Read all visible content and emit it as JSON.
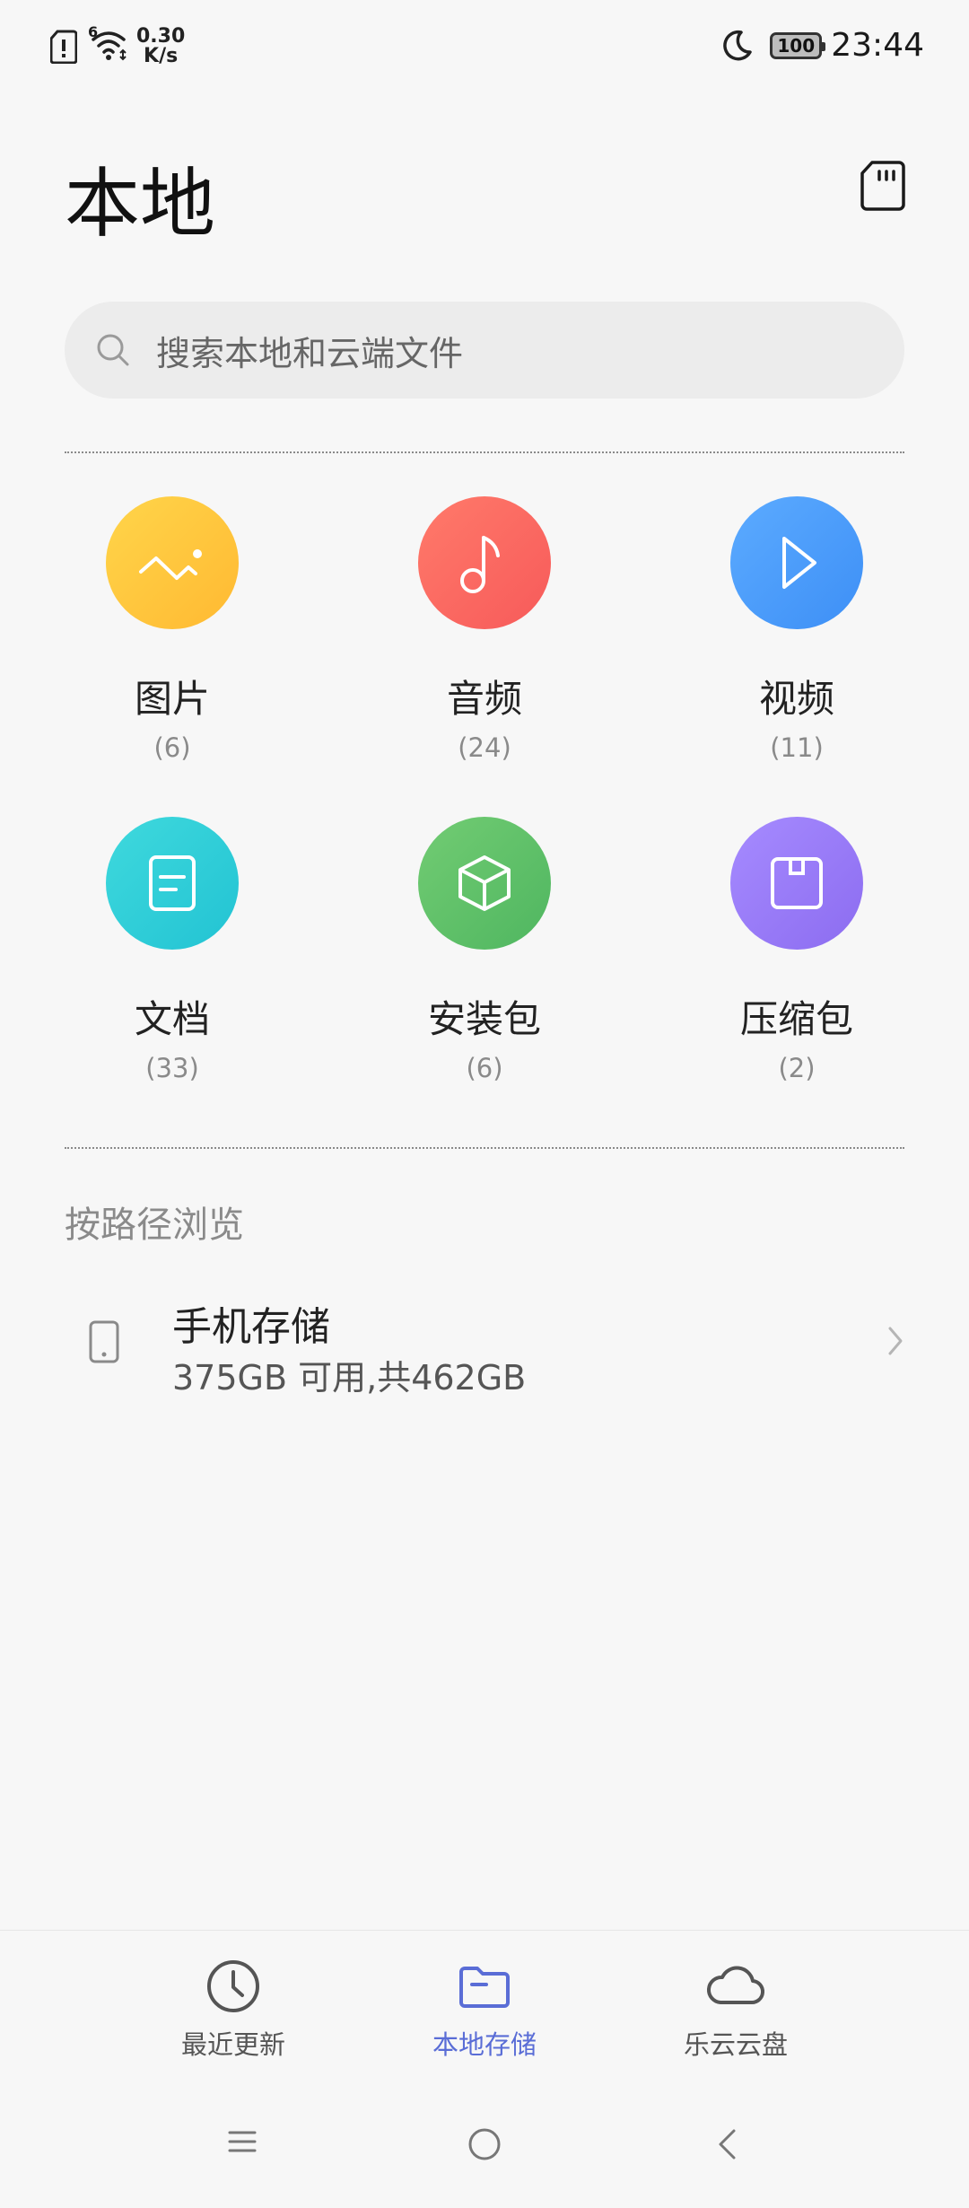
{
  "status_bar": {
    "net_speed_value": "0.30",
    "net_speed_unit": "K/s",
    "network_badge": "6",
    "battery": "100",
    "time": "23:44"
  },
  "header": {
    "title": "本地"
  },
  "search": {
    "placeholder": "搜索本地和云端文件"
  },
  "categories": [
    {
      "label": "图片",
      "count": "(6)",
      "icon": "image-icon",
      "color": "#ffc83f"
    },
    {
      "label": "音频",
      "count": "(24)",
      "icon": "music-note-icon",
      "color": "#ff6a61"
    },
    {
      "label": "视频",
      "count": "(11)",
      "icon": "play-icon",
      "color": "#4ea2ff"
    },
    {
      "label": "文档",
      "count": "(33)",
      "icon": "document-icon",
      "color": "#30cfd8"
    },
    {
      "label": "安装包",
      "count": "(6)",
      "icon": "package-icon",
      "color": "#5fc36f"
    },
    {
      "label": "压缩包",
      "count": "(2)",
      "icon": "archive-icon",
      "color": "#9b7cf6"
    }
  ],
  "browse": {
    "section_label": "按路径浏览",
    "storage_name": "手机存储",
    "storage_detail": "375GB 可用,共462GB"
  },
  "bottom_nav": [
    {
      "label": "最近更新",
      "icon": "clock-icon"
    },
    {
      "label": "本地存储",
      "icon": "folder-icon",
      "active": true
    },
    {
      "label": "乐云云盘",
      "icon": "cloud-icon"
    }
  ],
  "colors": {
    "accent": "#5a6dd6",
    "background": "#f7f7f7"
  }
}
